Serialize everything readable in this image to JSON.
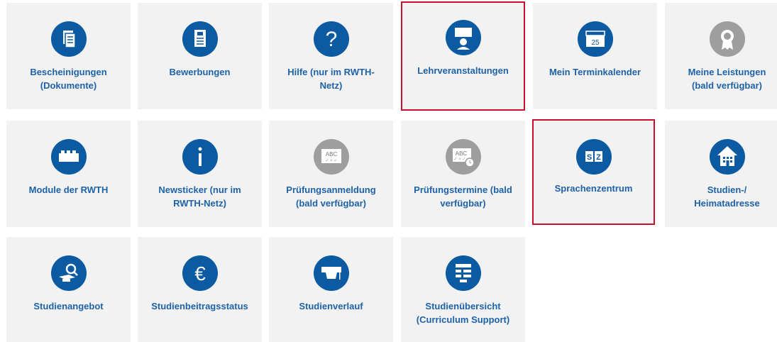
{
  "tiles": [
    {
      "lines": [
        "Bescheinigungen",
        "(Dokumente)"
      ],
      "icon": "documents-icon"
    },
    {
      "lines": [
        "Bewerbungen"
      ],
      "icon": "document-icon"
    },
    {
      "lines": [
        "Hilfe (nur im RWTH-",
        "Netz)"
      ],
      "icon": "question-icon"
    },
    {
      "lines": [
        "Lehrveranstaltungen"
      ],
      "icon": "lecturer-icon"
    },
    {
      "lines": [
        "Mein Terminkalender"
      ],
      "icon": "calendar-icon"
    },
    {
      "lines": [
        "Meine Leistungen",
        "(bald verfügbar)"
      ],
      "icon": "award-icon"
    },
    {
      "lines": [
        "Module der RWTH"
      ],
      "icon": "brick-icon"
    },
    {
      "lines": [
        "Newsticker (nur im",
        "RWTH-Netz)"
      ],
      "icon": "info-icon"
    },
    {
      "lines": [
        "Prüfungsanmeldung",
        "(bald verfügbar)"
      ],
      "icon": "abc-icon"
    },
    {
      "lines": [
        "Prüfungstermine (bald",
        "verfügbar)"
      ],
      "icon": "abc-clock-icon"
    },
    {
      "lines": [
        "Sprachenzentrum"
      ],
      "icon": "sz-icon"
    },
    {
      "lines": [
        "Studien-/",
        "Heimatadresse"
      ],
      "icon": "house-icon"
    },
    {
      "lines": [
        "Studienangebot"
      ],
      "icon": "magnifier-cap-icon"
    },
    {
      "lines": [
        "Studienbeitragsstatus"
      ],
      "icon": "euro-icon"
    },
    {
      "lines": [
        "Studienverlauf"
      ],
      "icon": "graduation-cap-icon"
    },
    {
      "lines": [
        "Studienübersicht",
        "(Curriculum Support)"
      ],
      "icon": "flowchart-icon"
    }
  ],
  "icon_text": {
    "calendar_day": "25",
    "abc": "ABC",
    "sz": "SZ"
  },
  "colors": {
    "accent": "#0b5aa2",
    "tile_bg": "#f2f2f2",
    "label": "#1e62a8",
    "highlight_border": "#c8102e",
    "disabled_icon": "#9e9e9e"
  }
}
